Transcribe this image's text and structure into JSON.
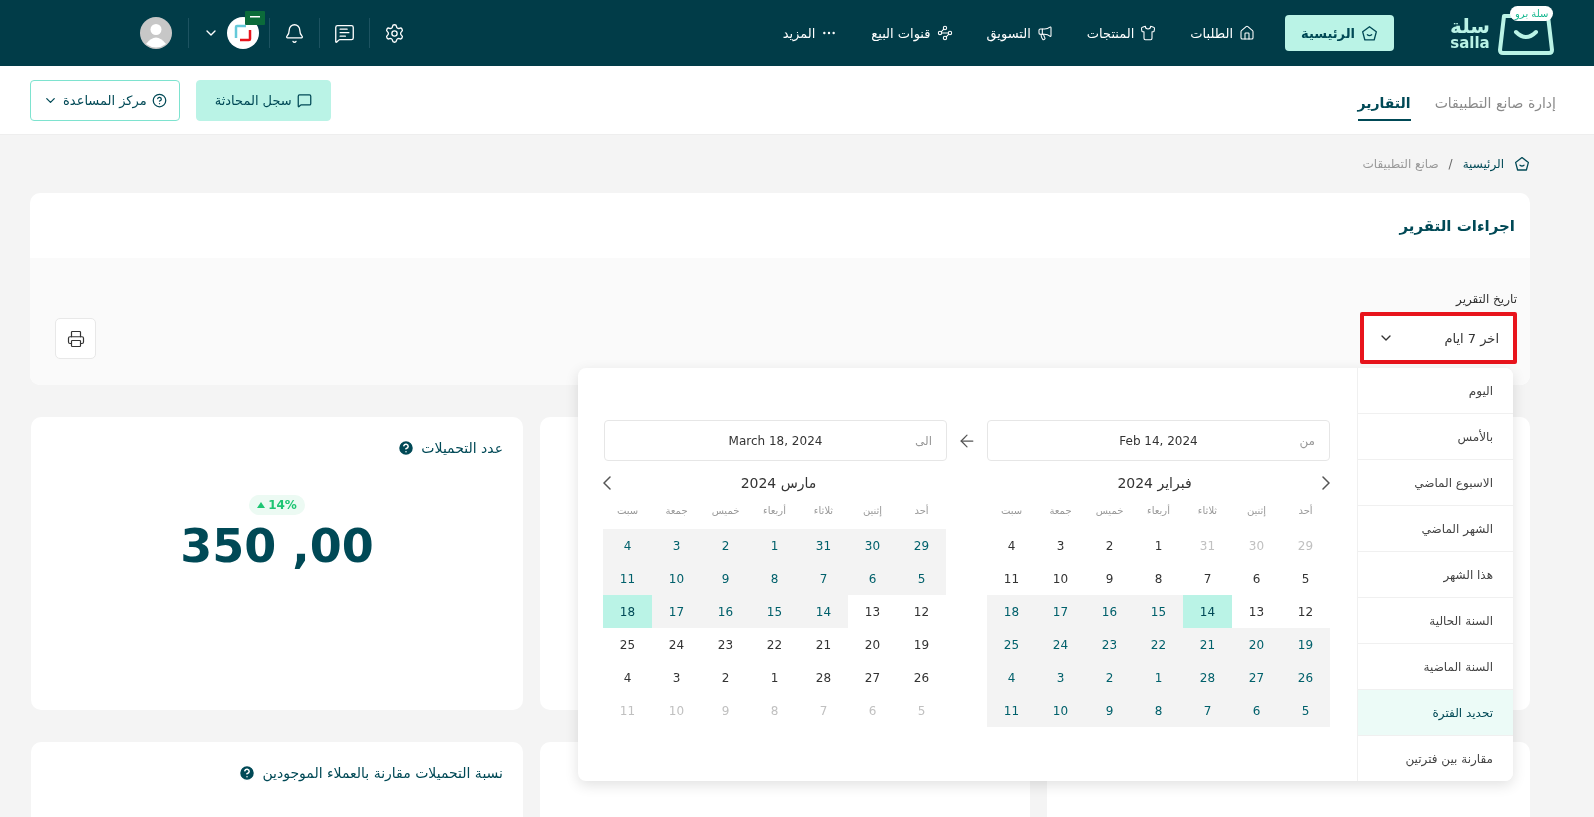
{
  "header": {
    "logo": {
      "text_ar": "سلة",
      "text_en": "salla",
      "badge": "سلة برو"
    },
    "nav": [
      {
        "label": "الرئيسية",
        "selected": true
      },
      {
        "label": "الطلبات",
        "selected": false
      },
      {
        "label": "المنتجات",
        "selected": false
      },
      {
        "label": "التسويق",
        "selected": false
      },
      {
        "label": "قنوات البيع",
        "selected": false
      },
      {
        "label": "المزيد",
        "selected": false
      }
    ]
  },
  "subnav": {
    "tabs": [
      {
        "label": "إدارة صانع التطبيقات",
        "selected": false
      },
      {
        "label": "التقارير",
        "selected": true
      }
    ],
    "buttons": [
      {
        "label": "سجل المحادثة",
        "kind": "primary"
      },
      {
        "label": "مركز المساعدة",
        "kind": "outline"
      }
    ]
  },
  "breadcrumb": {
    "items": [
      "الرئيسية",
      "صانع التطبيقات"
    ],
    "separator": "/"
  },
  "report_actions": {
    "title": "اجراءات التقرير",
    "date_label": "تاريخ التقرير",
    "date_select": {
      "value": "اخر 7 ايام",
      "highlighted": true
    }
  },
  "date_picker": {
    "presets": [
      {
        "label": "اليوم",
        "selected": false
      },
      {
        "label": "بالأمس",
        "selected": false
      },
      {
        "label": "الاسبوع الماضي",
        "selected": false
      },
      {
        "label": "الشهر الماضي",
        "selected": false
      },
      {
        "label": "هذا الشهر",
        "selected": false
      },
      {
        "label": "السنة الحالية",
        "selected": false
      },
      {
        "label": "السنة الماضية",
        "selected": false
      },
      {
        "label": "تحديد الفترة",
        "selected": true
      },
      {
        "label": "مقارنة بين فترتين",
        "selected": false
      }
    ],
    "from": {
      "label": "من",
      "value": "Feb 14, 2024"
    },
    "to": {
      "label": "الى",
      "value": "March 18, 2024"
    },
    "calendars": [
      {
        "title": "فبراير 2024",
        "weekdays": [
          "أحد",
          "إثنين",
          "ثلاثاء",
          "أربعاء",
          "خميس",
          "جمعة",
          "سبت"
        ],
        "weeks": [
          [
            {
              "d": "29",
              "selected": false,
              "in_range": false,
              "muted": true
            },
            {
              "d": "30",
              "selected": false,
              "in_range": false,
              "muted": true
            },
            {
              "d": "31",
              "selected": false,
              "in_range": false,
              "muted": true
            },
            {
              "d": "1",
              "selected": false,
              "in_range": false,
              "muted": false
            },
            {
              "d": "2",
              "selected": false,
              "in_range": false,
              "muted": false
            },
            {
              "d": "3",
              "selected": false,
              "in_range": false,
              "muted": false
            },
            {
              "d": "4",
              "selected": false,
              "in_range": false,
              "muted": false
            }
          ],
          [
            {
              "d": "5",
              "selected": false,
              "in_range": false,
              "muted": false
            },
            {
              "d": "6",
              "selected": false,
              "in_range": false,
              "muted": false
            },
            {
              "d": "7",
              "selected": false,
              "in_range": false,
              "muted": false
            },
            {
              "d": "8",
              "selected": false,
              "in_range": false,
              "muted": false
            },
            {
              "d": "9",
              "selected": false,
              "in_range": false,
              "muted": false
            },
            {
              "d": "10",
              "selected": false,
              "in_range": false,
              "muted": false
            },
            {
              "d": "11",
              "selected": false,
              "in_range": false,
              "muted": false
            }
          ],
          [
            {
              "d": "12",
              "selected": false,
              "in_range": false,
              "muted": false
            },
            {
              "d": "13",
              "selected": false,
              "in_range": false,
              "muted": false
            },
            {
              "d": "14",
              "selected": true,
              "in_range": true,
              "muted": false
            },
            {
              "d": "15",
              "selected": false,
              "in_range": true,
              "muted": false
            },
            {
              "d": "16",
              "selected": false,
              "in_range": true,
              "muted": false
            },
            {
              "d": "17",
              "selected": false,
              "in_range": true,
              "muted": false
            },
            {
              "d": "18",
              "selected": false,
              "in_range": true,
              "muted": false
            }
          ],
          [
            {
              "d": "19",
              "selected": false,
              "in_range": true,
              "muted": false
            },
            {
              "d": "20",
              "selected": false,
              "in_range": true,
              "muted": false
            },
            {
              "d": "21",
              "selected": false,
              "in_range": true,
              "muted": false
            },
            {
              "d": "22",
              "selected": false,
              "in_range": true,
              "muted": false
            },
            {
              "d": "23",
              "selected": false,
              "in_range": true,
              "muted": false
            },
            {
              "d": "24",
              "selected": false,
              "in_range": true,
              "muted": false
            },
            {
              "d": "25",
              "selected": false,
              "in_range": true,
              "muted": false
            }
          ],
          [
            {
              "d": "26",
              "selected": false,
              "in_range": true,
              "muted": false
            },
            {
              "d": "27",
              "selected": false,
              "in_range": true,
              "muted": false
            },
            {
              "d": "28",
              "selected": false,
              "in_range": true,
              "muted": false
            },
            {
              "d": "1",
              "selected": false,
              "in_range": true,
              "muted": false
            },
            {
              "d": "2",
              "selected": false,
              "in_range": true,
              "muted": false
            },
            {
              "d": "3",
              "selected": false,
              "in_range": true,
              "muted": false
            },
            {
              "d": "4",
              "selected": false,
              "in_range": true,
              "muted": false
            }
          ],
          [
            {
              "d": "5",
              "selected": false,
              "in_range": true,
              "muted": false
            },
            {
              "d": "6",
              "selected": false,
              "in_range": true,
              "muted": false
            },
            {
              "d": "7",
              "selected": false,
              "in_range": true,
              "muted": false
            },
            {
              "d": "8",
              "selected": false,
              "in_range": true,
              "muted": false
            },
            {
              "d": "9",
              "selected": false,
              "in_range": true,
              "muted": false
            },
            {
              "d": "10",
              "selected": false,
              "in_range": true,
              "muted": false
            },
            {
              "d": "11",
              "selected": false,
              "in_range": true,
              "muted": false
            }
          ]
        ]
      },
      {
        "title": "مارس 2024",
        "weekdays": [
          "أحد",
          "إثنين",
          "ثلاثاء",
          "أربعاء",
          "خميس",
          "جمعة",
          "سبت"
        ],
        "weeks": [
          [
            {
              "d": "29",
              "selected": false,
              "in_range": true,
              "muted": false
            },
            {
              "d": "30",
              "selected": false,
              "in_range": true,
              "muted": false
            },
            {
              "d": "31",
              "selected": false,
              "in_range": true,
              "muted": false
            },
            {
              "d": "1",
              "selected": false,
              "in_range": true,
              "muted": false
            },
            {
              "d": "2",
              "selected": false,
              "in_range": true,
              "muted": false
            },
            {
              "d": "3",
              "selected": false,
              "in_range": true,
              "muted": false
            },
            {
              "d": "4",
              "selected": false,
              "in_range": true,
              "muted": false
            }
          ],
          [
            {
              "d": "5",
              "selected": false,
              "in_range": true,
              "muted": false
            },
            {
              "d": "6",
              "selected": false,
              "in_range": true,
              "muted": false
            },
            {
              "d": "7",
              "selected": false,
              "in_range": true,
              "muted": false
            },
            {
              "d": "8",
              "selected": false,
              "in_range": true,
              "muted": false
            },
            {
              "d": "9",
              "selected": false,
              "in_range": true,
              "muted": false
            },
            {
              "d": "10",
              "selected": false,
              "in_range": true,
              "muted": false
            },
            {
              "d": "11",
              "selected": false,
              "in_range": true,
              "muted": false
            }
          ],
          [
            {
              "d": "12",
              "selected": false,
              "in_range": false,
              "muted": false
            },
            {
              "d": "13",
              "selected": false,
              "in_range": false,
              "muted": false
            },
            {
              "d": "14",
              "selected": false,
              "in_range": true,
              "muted": false
            },
            {
              "d": "15",
              "selected": false,
              "in_range": true,
              "muted": false
            },
            {
              "d": "16",
              "selected": false,
              "in_range": true,
              "muted": false
            },
            {
              "d": "17",
              "selected": false,
              "in_range": true,
              "muted": false
            },
            {
              "d": "18",
              "selected": true,
              "in_range": true,
              "muted": false
            }
          ],
          [
            {
              "d": "19",
              "selected": false,
              "in_range": false,
              "muted": false
            },
            {
              "d": "20",
              "selected": false,
              "in_range": false,
              "muted": false
            },
            {
              "d": "21",
              "selected": false,
              "in_range": false,
              "muted": false
            },
            {
              "d": "22",
              "selected": false,
              "in_range": false,
              "muted": false
            },
            {
              "d": "23",
              "selected": false,
              "in_range": false,
              "muted": false
            },
            {
              "d": "24",
              "selected": false,
              "in_range": false,
              "muted": false
            },
            {
              "d": "25",
              "selected": false,
              "in_range": false,
              "muted": false
            }
          ],
          [
            {
              "d": "26",
              "selected": false,
              "in_range": false,
              "muted": false
            },
            {
              "d": "27",
              "selected": false,
              "in_range": false,
              "muted": false
            },
            {
              "d": "28",
              "selected": false,
              "in_range": false,
              "muted": false
            },
            {
              "d": "1",
              "selected": false,
              "in_range": false,
              "muted": false
            },
            {
              "d": "2",
              "selected": false,
              "in_range": false,
              "muted": false
            },
            {
              "d": "3",
              "selected": false,
              "in_range": false,
              "muted": false
            },
            {
              "d": "4",
              "selected": false,
              "in_range": false,
              "muted": false
            }
          ],
          [
            {
              "d": "5",
              "selected": false,
              "in_range": false,
              "muted": true
            },
            {
              "d": "6",
              "selected": false,
              "in_range": false,
              "muted": true
            },
            {
              "d": "7",
              "selected": false,
              "in_range": false,
              "muted": true
            },
            {
              "d": "8",
              "selected": false,
              "in_range": false,
              "muted": true
            },
            {
              "d": "9",
              "selected": false,
              "in_range": false,
              "muted": true
            },
            {
              "d": "10",
              "selected": false,
              "in_range": false,
              "muted": true
            },
            {
              "d": "11",
              "selected": false,
              "in_range": false,
              "muted": true
            }
          ]
        ]
      }
    ]
  },
  "metric_card": {
    "title": "عدد التحميلات",
    "change": "14%",
    "rising": true,
    "value": "350 ,00"
  },
  "chart_card": {
    "title": "نسبة التحميلات مقارنة بالعملاء الموجودين"
  }
}
